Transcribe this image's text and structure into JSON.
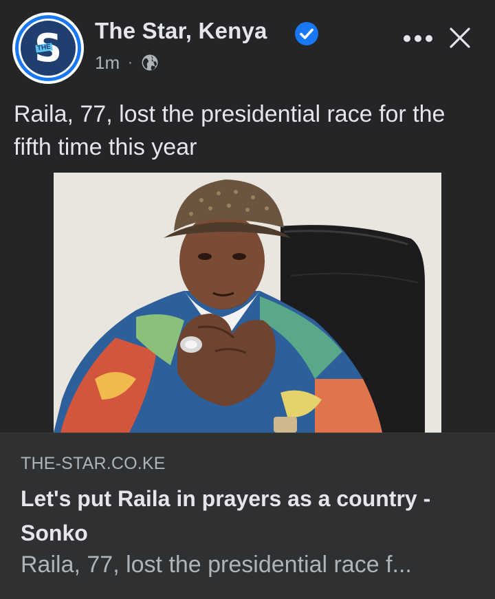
{
  "post": {
    "page_name": "The Star, Kenya",
    "timestamp": "1m",
    "separator": "·",
    "audience_icon": "globe-icon",
    "verified_icon": "verified-badge-icon",
    "caption": "Raila, 77, lost the presidential race for the fifth time this year",
    "avatar": {
      "letter": "S",
      "badge_text": "THE"
    }
  },
  "link_preview": {
    "domain": "THE-STAR.CO.KE",
    "title": "Let's put Raila in prayers as a country - Sonko",
    "description": "Raila, 77, lost the presidential race f..."
  },
  "colors": {
    "background": "#242526",
    "card_background": "#2f3031",
    "primary_text": "#e4e6eb",
    "secondary_text": "#b0b3b8",
    "verified_blue": "#1877f2"
  }
}
